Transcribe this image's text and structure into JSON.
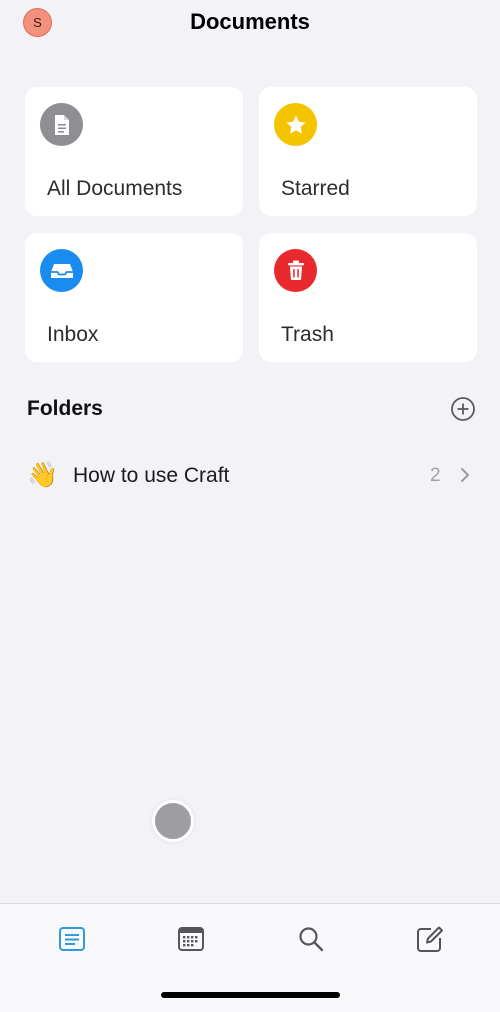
{
  "header": {
    "avatar_initial": "S",
    "title": "Documents"
  },
  "cards": [
    {
      "label": "All Documents",
      "icon": "document-icon",
      "color": "#8e8e93"
    },
    {
      "label": "Starred",
      "icon": "star-icon",
      "color": "#f5c400"
    },
    {
      "label": "Inbox",
      "icon": "inbox-tray-icon",
      "color": "#1a8cf0"
    },
    {
      "label": "Trash",
      "icon": "trash-icon",
      "color": "#e8292e"
    }
  ],
  "folders": {
    "title": "Folders",
    "add_icon": "plus-circle-icon",
    "items": [
      {
        "emoji": "👋",
        "name": "How to use Craft",
        "count": "2"
      }
    ]
  },
  "tabbar": {
    "active_color": "#2d9cdb",
    "tabs": [
      {
        "icon": "documents-tab-icon",
        "active": true
      },
      {
        "icon": "calendar-icon",
        "active": false
      },
      {
        "icon": "search-icon",
        "active": false
      },
      {
        "icon": "compose-icon",
        "active": false
      }
    ]
  }
}
